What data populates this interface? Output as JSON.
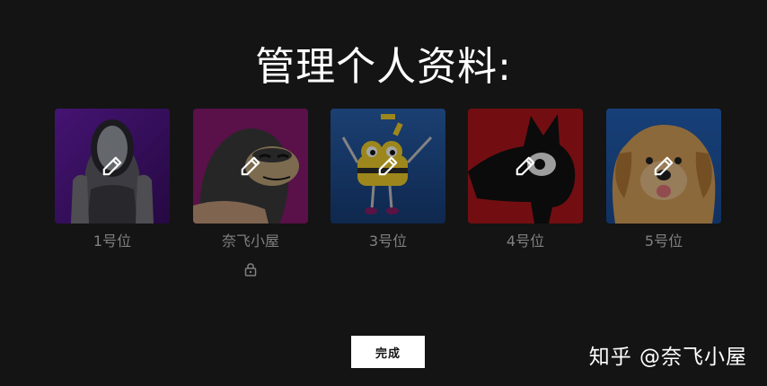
{
  "page": {
    "title": "管理个人资料:"
  },
  "profiles": [
    {
      "name": "1号位",
      "avatar_icon": "robot-avatar-icon",
      "locked": false,
      "bg": "#5b1a8c"
    },
    {
      "name": "奈飞小屋",
      "avatar_icon": "gorilla-avatar-icon",
      "locked": true,
      "bg": "#8b1a6f"
    },
    {
      "name": "3号位",
      "avatar_icon": "yellow-creature-avatar-icon",
      "locked": false,
      "bg": "#1f4f93"
    },
    {
      "name": "4号位",
      "avatar_icon": "black-creature-avatar-icon",
      "locked": false,
      "bg": "#a3161c"
    },
    {
      "name": "5号位",
      "avatar_icon": "dog-avatar-icon",
      "locked": false,
      "bg": "#1f56a6"
    }
  ],
  "actions": {
    "done_label": "完成"
  },
  "watermark": {
    "text": "知乎 @奈飞小屋"
  },
  "colors": {
    "background": "#141414",
    "name_text": "#808080",
    "button_bg": "#ffffff"
  }
}
